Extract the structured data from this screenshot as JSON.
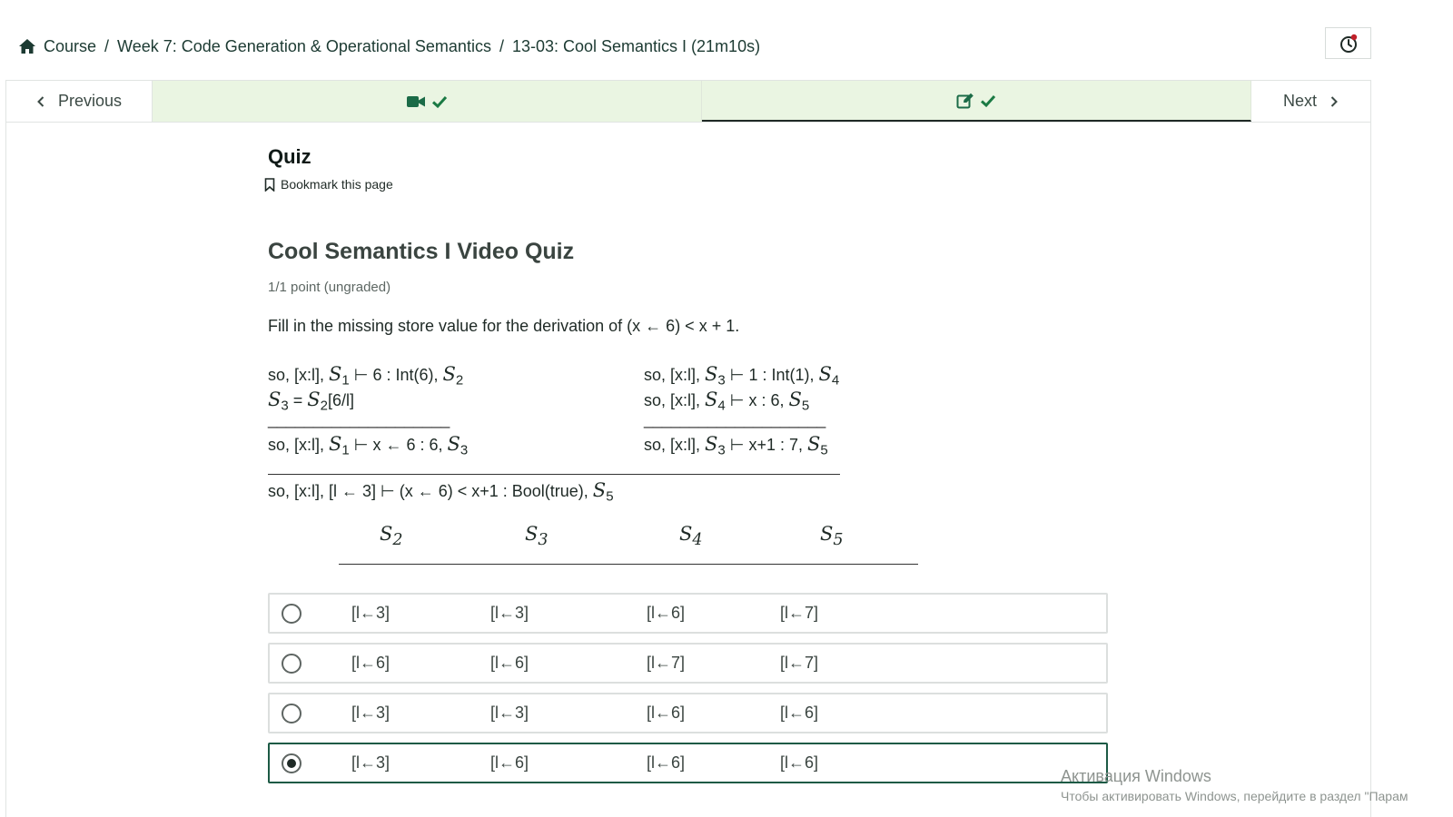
{
  "breadcrumb": {
    "items": [
      "Course",
      "Week 7: Code Generation & Operational Semantics",
      "13-03: Cool Semantics I (21m10s)"
    ],
    "separator": "/"
  },
  "nav": {
    "previous_label": "Previous",
    "next_label": "Next",
    "units": [
      {
        "icon": "video-icon",
        "status": "check-icon",
        "active": false
      },
      {
        "icon": "edit-icon",
        "status": "check-icon",
        "active": true
      }
    ]
  },
  "quiz": {
    "heading": "Quiz",
    "bookmark_label": "Bookmark this page",
    "title": "Cool Semantics I Video Quiz",
    "points": "1/1 point (ungraded)",
    "prompt": "Fill in the missing store value for the derivation of (x ← 6) < x + 1."
  },
  "derivation": {
    "left_premise_1": {
      "pre": "so, [x:l], ",
      "sym1": "S",
      "sub1": "1",
      "mid": " ⊢ 6 : Int(6), ",
      "sym2": "S",
      "sub2": "2"
    },
    "left_premise_2": {
      "sym1": "S",
      "sub1": "3",
      "mid": " = ",
      "sym2": "S",
      "sub2": "2",
      "post": "[6/l]"
    },
    "left_rule_text": "____________________",
    "left_conclusion": {
      "pre": "so, [x:l], ",
      "sym1": "S",
      "sub1": "1",
      "mid": " ⊢ x ← 6 : 6, ",
      "sym2": "S",
      "sub2": "3"
    },
    "right_premise_1": {
      "pre": "so, [x:l], ",
      "sym1": "S",
      "sub1": "3",
      "mid": " ⊢ 1 : Int(1), ",
      "sym2": "S",
      "sub2": "4"
    },
    "right_premise_2": {
      "pre": "so, [x:l], ",
      "sym1": "S",
      "sub1": "4",
      "mid": " ⊢ x : 6, ",
      "sym2": "S",
      "sub2": "5"
    },
    "right_rule_text": "____________________",
    "right_conclusion": {
      "pre": "so, [x:l], ",
      "sym1": "S",
      "sub1": "3",
      "mid": " ⊢ x+1 : 7, ",
      "sym2": "S",
      "sub2": "5"
    },
    "final_conclusion": {
      "pre": "so, [x:l], [l ← 3] ⊢ (x ← 6) <  x+1 : Bool(true), ",
      "sym": "S",
      "sub": "5"
    }
  },
  "columns": [
    {
      "sym": "S",
      "sub": "2"
    },
    {
      "sym": "S",
      "sub": "3"
    },
    {
      "sym": "S",
      "sub": "4"
    },
    {
      "sym": "S",
      "sub": "5"
    }
  ],
  "choices": [
    {
      "values": [
        "[l←3]",
        "[l←3]",
        "[l←6]",
        "[l←7]"
      ],
      "selected": false
    },
    {
      "values": [
        "[l←6]",
        "[l←6]",
        "[l←7]",
        "[l←7]"
      ],
      "selected": false
    },
    {
      "values": [
        "[l←3]",
        "[l←3]",
        "[l←6]",
        "[l←6]"
      ],
      "selected": false
    },
    {
      "values": [
        "[l←3]",
        "[l←6]",
        "[l←6]",
        "[l←6]"
      ],
      "selected": true
    }
  ],
  "watermark": {
    "line1": "Активация Windows",
    "line2": "Чтобы активировать Windows, перейдите в раздел \"Парам"
  },
  "colors": {
    "accent": "#1c5a45",
    "unit_bg": "#eaf5e2",
    "check": "#1b7a44"
  }
}
